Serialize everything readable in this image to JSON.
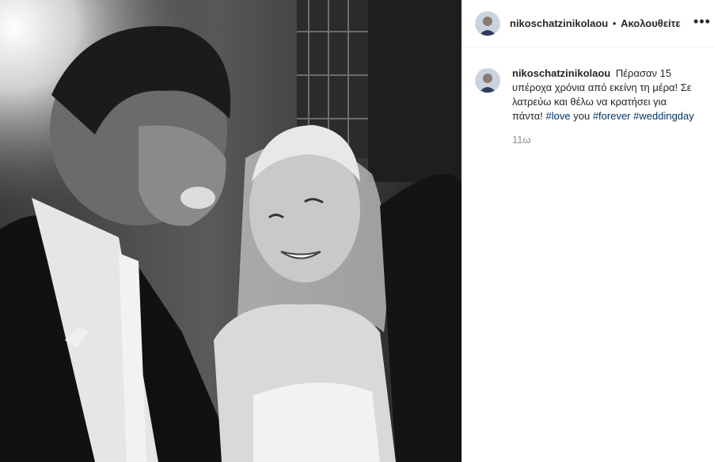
{
  "post": {
    "username": "nikoschatzinikolaou",
    "separator": "•",
    "follow_label": "Ακολουθείτε",
    "more_icon": "more-horizontal-icon"
  },
  "caption": {
    "username": "nikoschatzinikolaou",
    "text_1": "Πέρασαν 15 υπέροχα χρόνια από εκείνη τη μέρα! Σε λατρεύω και θέλω να κρατήσει για πάντα!",
    "tag_love": "#love",
    "text_2": "you",
    "tag_forever": "#forever",
    "tag_weddingday": "#weddingday",
    "timestamp": "11ω"
  },
  "colors": {
    "hashtag": "#003569",
    "timestamp": "#8e8e8e",
    "divider": "#efefef"
  }
}
